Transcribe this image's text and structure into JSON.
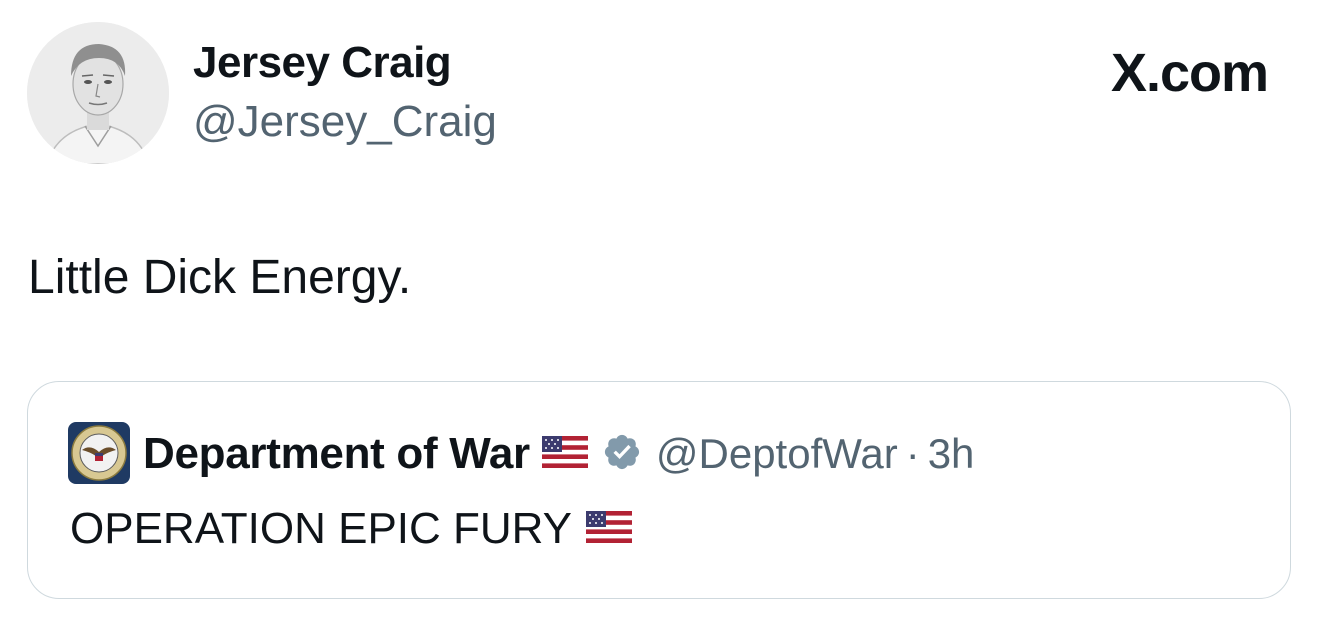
{
  "post": {
    "author": {
      "name": "Jersey Craig",
      "handle": "@Jersey_Craig",
      "avatar_icon": "person-portrait-avatar"
    },
    "brand": "X.com",
    "text": "Little Dick Energy."
  },
  "quoted_post": {
    "author": {
      "name": "Department of War",
      "handle": "@DeptofWar",
      "avatar_icon": "department-seal-avatar",
      "verified": true
    },
    "separator": "·",
    "time": "3h",
    "text": "OPERATION EPIC FURY",
    "flag_icon": "us-flag-icon",
    "verified_icon": "verified-badge-icon"
  },
  "colors": {
    "text_primary": "#0f1419",
    "text_secondary": "#536471",
    "card_border": "#cfd9de",
    "verified_badge": "#829aab"
  }
}
